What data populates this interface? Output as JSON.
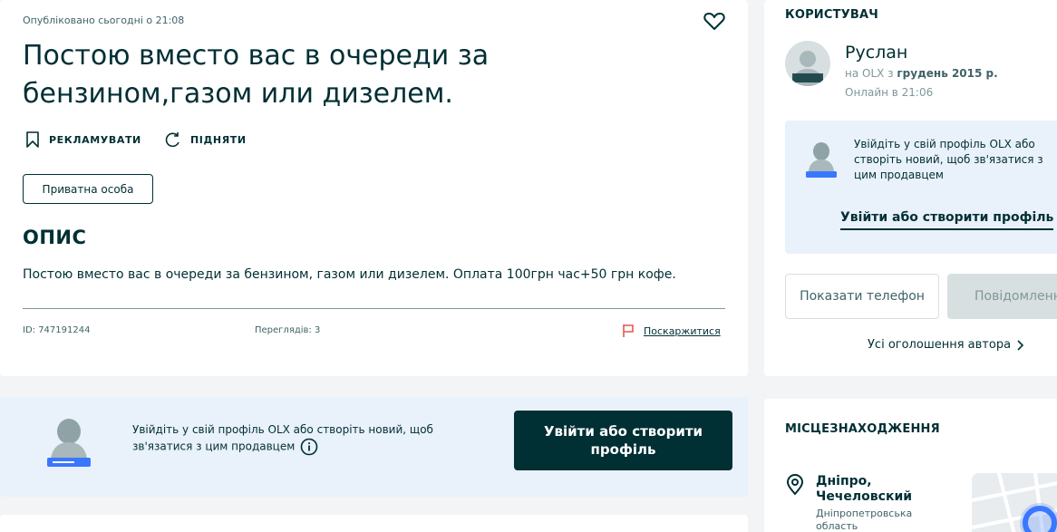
{
  "listing": {
    "published": "Опубліковано сьогодні о 21:08",
    "title": "Постою вместо вас в очереди за бензином,газом или дизелем.",
    "promote_label": "РЕКЛАМУВАТИ",
    "raise_label": "ПІДНЯТИ",
    "seller_type": "Приватна особа",
    "description_heading": "ОПИС",
    "description": "Постою вместо вас в очереди за бензином, газом или дизелем. Оплата 100грн час+50 грн кофе.",
    "id_text": "ID: 747191244",
    "views_text": "Переглядів: 3",
    "report_label": "Поскаржитися"
  },
  "cta": {
    "text": "Увійдіть у свій профіль OLX або створіть новий, щоб зв'язатися з цим продавцем",
    "button_label": "Увійти або створити профіль"
  },
  "user": {
    "heading": "КОРИСТУВАЧ",
    "name": "Руслан",
    "since_prefix": "на OLX з",
    "since_date": "грудень 2015 р.",
    "online": "Онлайн в 21:06",
    "login_text": "Увійдіть у свій профіль OLX або створіть новий, щоб зв'язатися з цим продавцем",
    "login_link": "Увійти або створити профіль",
    "show_phone": "Показати телефон",
    "message": "Повідомлення",
    "all_ads": "Усі оголошення автора"
  },
  "location": {
    "heading": "МІСЦЕЗНАХОДЖЕННЯ",
    "city": "Дніпро, Чечеловский",
    "region": "Дніпропетровська область"
  },
  "colors": {
    "primary": "#002f34",
    "cta_bg": "#e9f1fb",
    "report_flag": "#e4584f"
  },
  "icons": [
    "heart-icon",
    "bookmark-icon",
    "refresh-icon",
    "flag-icon",
    "info-icon",
    "chevron-right-icon",
    "location-pin-icon"
  ]
}
